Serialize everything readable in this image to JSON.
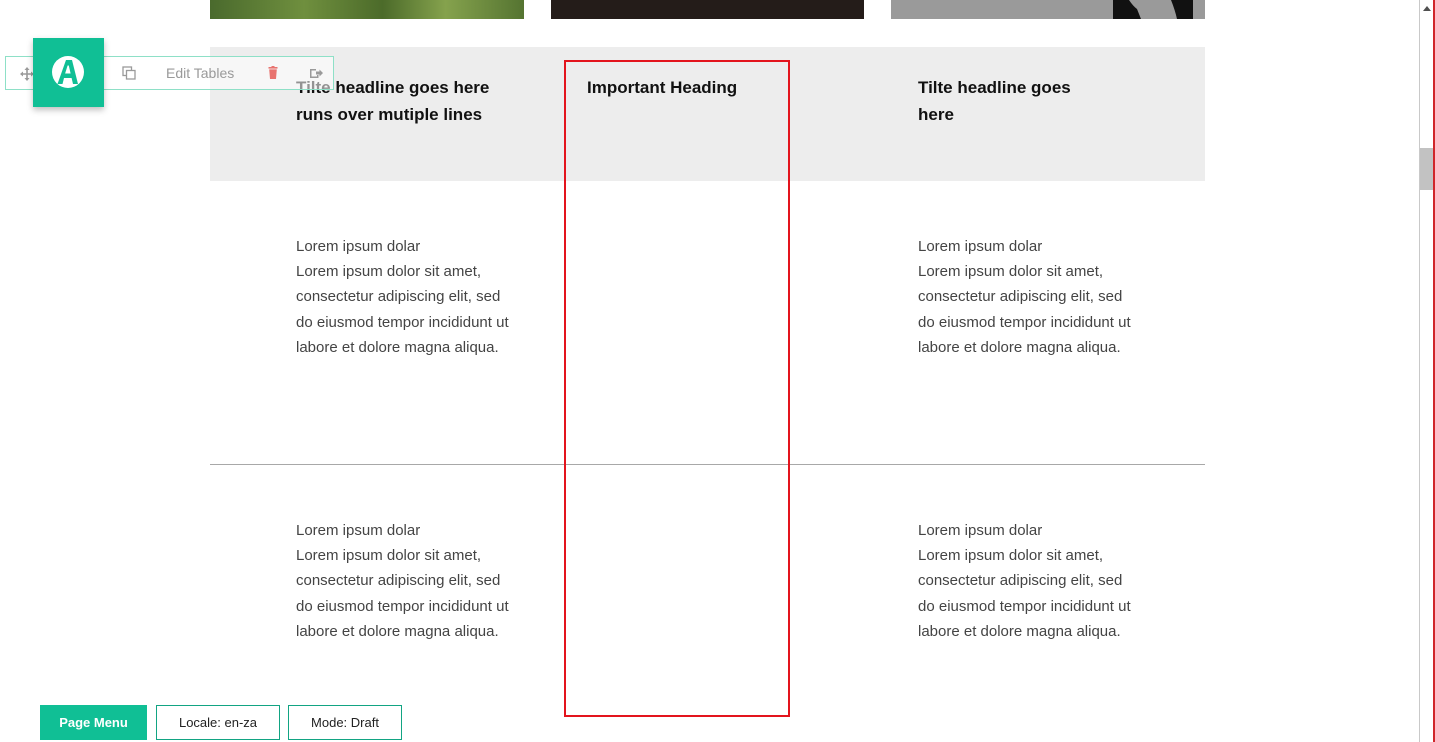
{
  "table": {
    "headings": [
      "Tilte headline goes here runs over mutiple lines",
      "Important Heading",
      "Tilte headline goes here"
    ],
    "rows": [
      [
        "Lorem ipsum dolar\nLorem ipsum dolor sit amet, consectetur adipiscing elit, sed do eiusmod tempor incididunt ut labore et dolore magna aliqua.",
        "",
        "Lorem ipsum dolar\nLorem ipsum dolor sit amet, consectetur adipiscing elit, sed do eiusmod tempor incididunt ut labore et dolore magna aliqua."
      ],
      [
        "Lorem ipsum dolar\nLorem ipsum dolor sit amet, consectetur adipiscing elit, sed do eiusmod tempor incididunt ut labore et dolore magna aliqua.",
        "",
        "Lorem ipsum dolar\nLorem ipsum dolor sit amet, consectetur adipiscing elit, sed do eiusmod tempor incididunt ut labore et dolore magna aliqua."
      ]
    ]
  },
  "toolbar": {
    "edit_label": "Edit Tables",
    "icons": [
      "move-icon",
      "copy-icon",
      "trash-icon",
      "export-icon"
    ]
  },
  "bottom_bar": {
    "page_menu": "Page Menu",
    "locale": "Locale: en-za",
    "mode": "Mode: Draft"
  },
  "colors": {
    "accent": "#10bf95",
    "selection": "#e3141d",
    "header_band": "#ededed",
    "trash": "#e8736f"
  }
}
